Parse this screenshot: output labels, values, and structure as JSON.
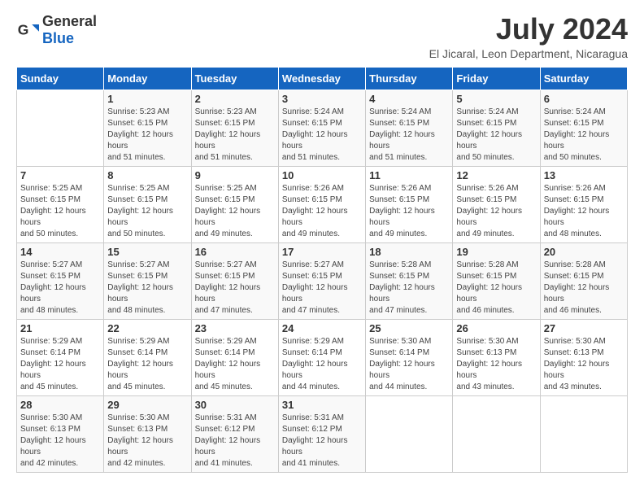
{
  "header": {
    "logo": {
      "general": "General",
      "blue": "Blue"
    },
    "title": "July 2024",
    "subtitle": "El Jicaral, Leon Department, Nicaragua"
  },
  "calendar": {
    "days_of_week": [
      "Sunday",
      "Monday",
      "Tuesday",
      "Wednesday",
      "Thursday",
      "Friday",
      "Saturday"
    ],
    "weeks": [
      [
        {
          "day": "",
          "sunrise": "",
          "sunset": "",
          "daylight": ""
        },
        {
          "day": "1",
          "sunrise": "Sunrise: 5:23 AM",
          "sunset": "Sunset: 6:15 PM",
          "daylight": "Daylight: 12 hours and 51 minutes."
        },
        {
          "day": "2",
          "sunrise": "Sunrise: 5:23 AM",
          "sunset": "Sunset: 6:15 PM",
          "daylight": "Daylight: 12 hours and 51 minutes."
        },
        {
          "day": "3",
          "sunrise": "Sunrise: 5:24 AM",
          "sunset": "Sunset: 6:15 PM",
          "daylight": "Daylight: 12 hours and 51 minutes."
        },
        {
          "day": "4",
          "sunrise": "Sunrise: 5:24 AM",
          "sunset": "Sunset: 6:15 PM",
          "daylight": "Daylight: 12 hours and 51 minutes."
        },
        {
          "day": "5",
          "sunrise": "Sunrise: 5:24 AM",
          "sunset": "Sunset: 6:15 PM",
          "daylight": "Daylight: 12 hours and 50 minutes."
        },
        {
          "day": "6",
          "sunrise": "Sunrise: 5:24 AM",
          "sunset": "Sunset: 6:15 PM",
          "daylight": "Daylight: 12 hours and 50 minutes."
        }
      ],
      [
        {
          "day": "7",
          "sunrise": "Sunrise: 5:25 AM",
          "sunset": "Sunset: 6:15 PM",
          "daylight": "Daylight: 12 hours and 50 minutes."
        },
        {
          "day": "8",
          "sunrise": "Sunrise: 5:25 AM",
          "sunset": "Sunset: 6:15 PM",
          "daylight": "Daylight: 12 hours and 50 minutes."
        },
        {
          "day": "9",
          "sunrise": "Sunrise: 5:25 AM",
          "sunset": "Sunset: 6:15 PM",
          "daylight": "Daylight: 12 hours and 49 minutes."
        },
        {
          "day": "10",
          "sunrise": "Sunrise: 5:26 AM",
          "sunset": "Sunset: 6:15 PM",
          "daylight": "Daylight: 12 hours and 49 minutes."
        },
        {
          "day": "11",
          "sunrise": "Sunrise: 5:26 AM",
          "sunset": "Sunset: 6:15 PM",
          "daylight": "Daylight: 12 hours and 49 minutes."
        },
        {
          "day": "12",
          "sunrise": "Sunrise: 5:26 AM",
          "sunset": "Sunset: 6:15 PM",
          "daylight": "Daylight: 12 hours and 49 minutes."
        },
        {
          "day": "13",
          "sunrise": "Sunrise: 5:26 AM",
          "sunset": "Sunset: 6:15 PM",
          "daylight": "Daylight: 12 hours and 48 minutes."
        }
      ],
      [
        {
          "day": "14",
          "sunrise": "Sunrise: 5:27 AM",
          "sunset": "Sunset: 6:15 PM",
          "daylight": "Daylight: 12 hours and 48 minutes."
        },
        {
          "day": "15",
          "sunrise": "Sunrise: 5:27 AM",
          "sunset": "Sunset: 6:15 PM",
          "daylight": "Daylight: 12 hours and 48 minutes."
        },
        {
          "day": "16",
          "sunrise": "Sunrise: 5:27 AM",
          "sunset": "Sunset: 6:15 PM",
          "daylight": "Daylight: 12 hours and 47 minutes."
        },
        {
          "day": "17",
          "sunrise": "Sunrise: 5:27 AM",
          "sunset": "Sunset: 6:15 PM",
          "daylight": "Daylight: 12 hours and 47 minutes."
        },
        {
          "day": "18",
          "sunrise": "Sunrise: 5:28 AM",
          "sunset": "Sunset: 6:15 PM",
          "daylight": "Daylight: 12 hours and 47 minutes."
        },
        {
          "day": "19",
          "sunrise": "Sunrise: 5:28 AM",
          "sunset": "Sunset: 6:15 PM",
          "daylight": "Daylight: 12 hours and 46 minutes."
        },
        {
          "day": "20",
          "sunrise": "Sunrise: 5:28 AM",
          "sunset": "Sunset: 6:15 PM",
          "daylight": "Daylight: 12 hours and 46 minutes."
        }
      ],
      [
        {
          "day": "21",
          "sunrise": "Sunrise: 5:29 AM",
          "sunset": "Sunset: 6:14 PM",
          "daylight": "Daylight: 12 hours and 45 minutes."
        },
        {
          "day": "22",
          "sunrise": "Sunrise: 5:29 AM",
          "sunset": "Sunset: 6:14 PM",
          "daylight": "Daylight: 12 hours and 45 minutes."
        },
        {
          "day": "23",
          "sunrise": "Sunrise: 5:29 AM",
          "sunset": "Sunset: 6:14 PM",
          "daylight": "Daylight: 12 hours and 45 minutes."
        },
        {
          "day": "24",
          "sunrise": "Sunrise: 5:29 AM",
          "sunset": "Sunset: 6:14 PM",
          "daylight": "Daylight: 12 hours and 44 minutes."
        },
        {
          "day": "25",
          "sunrise": "Sunrise: 5:30 AM",
          "sunset": "Sunset: 6:14 PM",
          "daylight": "Daylight: 12 hours and 44 minutes."
        },
        {
          "day": "26",
          "sunrise": "Sunrise: 5:30 AM",
          "sunset": "Sunset: 6:13 PM",
          "daylight": "Daylight: 12 hours and 43 minutes."
        },
        {
          "day": "27",
          "sunrise": "Sunrise: 5:30 AM",
          "sunset": "Sunset: 6:13 PM",
          "daylight": "Daylight: 12 hours and 43 minutes."
        }
      ],
      [
        {
          "day": "28",
          "sunrise": "Sunrise: 5:30 AM",
          "sunset": "Sunset: 6:13 PM",
          "daylight": "Daylight: 12 hours and 42 minutes."
        },
        {
          "day": "29",
          "sunrise": "Sunrise: 5:30 AM",
          "sunset": "Sunset: 6:13 PM",
          "daylight": "Daylight: 12 hours and 42 minutes."
        },
        {
          "day": "30",
          "sunrise": "Sunrise: 5:31 AM",
          "sunset": "Sunset: 6:12 PM",
          "daylight": "Daylight: 12 hours and 41 minutes."
        },
        {
          "day": "31",
          "sunrise": "Sunrise: 5:31 AM",
          "sunset": "Sunset: 6:12 PM",
          "daylight": "Daylight: 12 hours and 41 minutes."
        },
        {
          "day": "",
          "sunrise": "",
          "sunset": "",
          "daylight": ""
        },
        {
          "day": "",
          "sunrise": "",
          "sunset": "",
          "daylight": ""
        },
        {
          "day": "",
          "sunrise": "",
          "sunset": "",
          "daylight": ""
        }
      ]
    ]
  }
}
